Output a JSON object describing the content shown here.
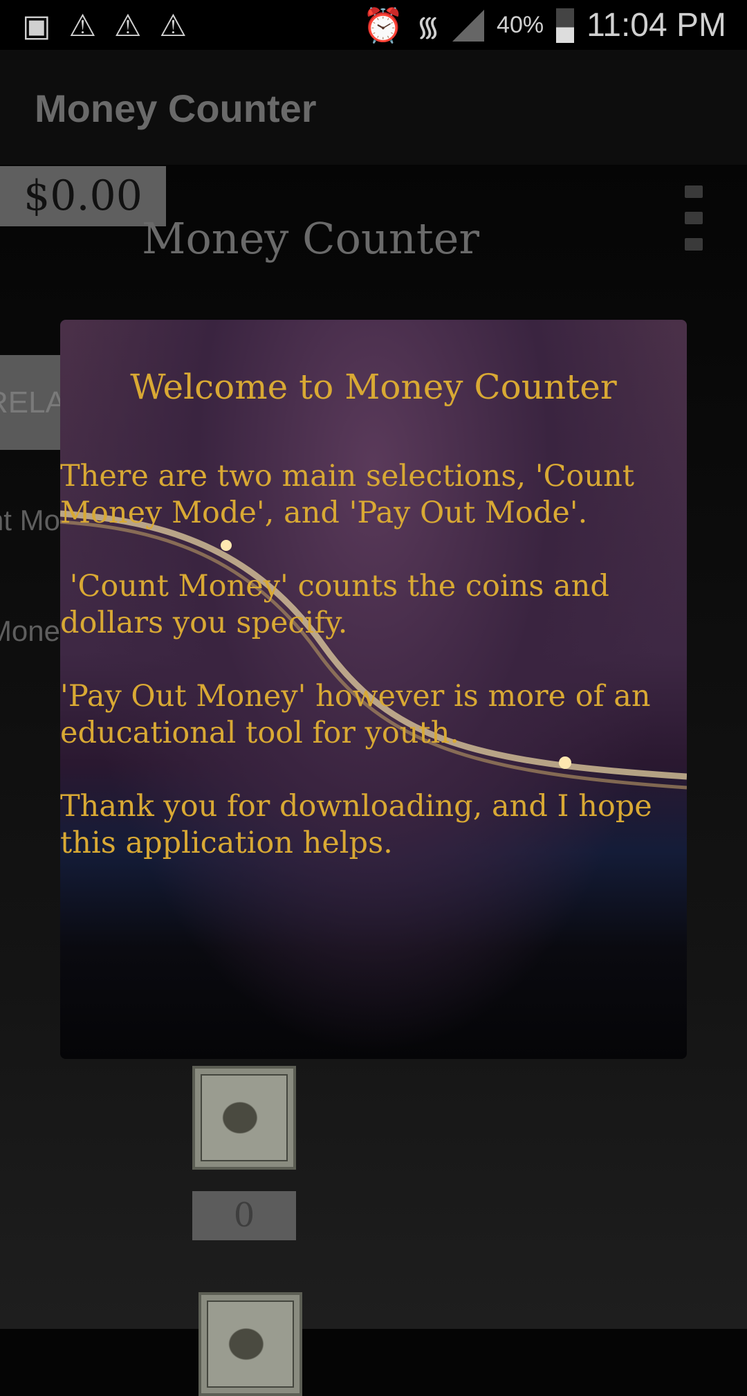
{
  "status_bar": {
    "icons_left": [
      "image-icon",
      "warning-icon",
      "warning-icon",
      "warning-icon"
    ],
    "battery": "40%",
    "time": "11:04 PM"
  },
  "app_bar": {
    "title": "Money Counter"
  },
  "main": {
    "total": "$0.00",
    "subtitle": "Money Counter",
    "reset_partial": "RELA",
    "side_labels": [
      "nt Mo",
      "Mone"
    ],
    "bill_count": "0"
  },
  "dialog": {
    "title": "Welcome to Money Counter",
    "paragraphs": [
      "There are two main selections, 'Count Money Mode', and 'Pay Out Mode'.",
      " 'Count Money' counts the coins and dollars you specify.",
      "'Pay Out Money' however is more of an educational tool for youth.",
      "Thank you for downloading, and I hope this application helps."
    ],
    "text_color": "#d9a934"
  }
}
